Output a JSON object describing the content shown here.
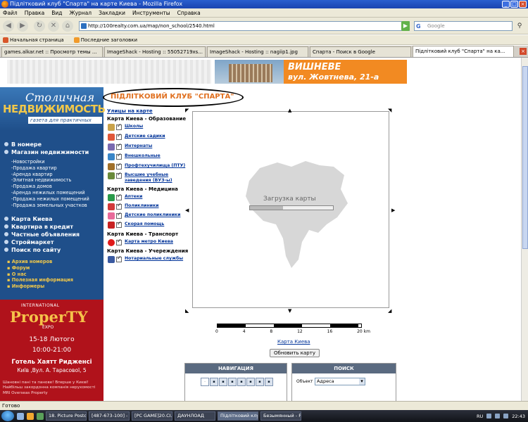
{
  "window": {
    "title": "Підлітковий клуб \"Спарта\" на карте Киева - Mozilla Firefox",
    "buttons": [
      "_",
      "□",
      "×"
    ]
  },
  "menu": [
    "Файл",
    "Правка",
    "Вид",
    "Журнал",
    "Закладки",
    "Инструменты",
    "Справка"
  ],
  "nav": {
    "url": "http://100realty.com.ua/map/non_school/2540.html",
    "search_placeholder": "Google"
  },
  "bookmarks": [
    "Начальная страница",
    "Последние заголовки"
  ],
  "tabs": [
    {
      "label": "games.alkar.net :: Просмотр темы ...",
      "active": false
    },
    {
      "label": "ImageShack - Hosting :: 55052719xs...",
      "active": false
    },
    {
      "label": "ImageShack - Hosting :: nagiip1.jpg",
      "active": false
    },
    {
      "label": "Спарта - Поиск в Google",
      "active": false
    },
    {
      "label": "Підлітковий клуб \"Спарта\" на ка...",
      "active": true
    }
  ],
  "banner": {
    "line1": "ВИШНЕВЕ",
    "line2": "вул. Жовтнева, 21-а"
  },
  "logo": {
    "top": "Столичная",
    "main": "НЕДВИЖИМОСТЬ",
    "tagline": "газета для практичных"
  },
  "sidebar": {
    "main_top": [
      "В номере",
      "Магазин недвижимости"
    ],
    "sub": [
      "-Новостройки",
      "-Продажа квартир",
      "-Аренда квартир",
      "-Элитная недвижимость",
      "-Продажа домов",
      "-Аренда нежилых помещений",
      "-Продажа нежилых помещений",
      "-Продажа земельных участков"
    ],
    "main_bottom": [
      "Карта Киева",
      "Квартира в кредит",
      "Частные объявления",
      "Строймаркет",
      "Поиск по сайту"
    ],
    "extra": [
      "Архив номеров",
      "Форум",
      "О нас",
      "Полезная информация",
      "Информеры"
    ]
  },
  "promo": {
    "top": "INTERNATIONAL",
    "brand": "ProperTY",
    "expo": "EXPO",
    "dates": "15-18 Лютого",
    "time": "10:00-21:00",
    "venue": "Готель Хаятт Ридженсі",
    "address": "Київ ,Вул. А. Тарасової, 5",
    "desc": "Шановні пані та панове! Вперше у Києві! Найбільш закордонна компанія нерухомості MRI Overseas Property"
  },
  "main": {
    "title": "ПІДЛІТКОВИЙ КЛУБ \"СПАРТА\"",
    "streets_link": "Улицы на карте",
    "groups": [
      {
        "header": "Карта Киева - Образование",
        "items": [
          "Школы",
          "Детские садики",
          "Интернаты",
          "Внешкольные",
          "Профтехучилища (ПТУ)",
          "Высшие учебные заведения (ВУЗ-ы)"
        ]
      },
      {
        "header": "Карта Киева - Медицина",
        "items": [
          "Аптеки",
          "Поликлиники",
          "Детские поликлиники",
          "Скорая помощь"
        ]
      },
      {
        "header": "Карта Киева - Транспорт",
        "items": [
          "Карта метро Киева"
        ]
      },
      {
        "header": "Карта Киева - Учереждения",
        "items": [
          "Нотариальные службы"
        ]
      }
    ],
    "loading_text": "Загрузка карты",
    "loading_progress": 0.4,
    "scale_labels": [
      "0",
      "4",
      "8",
      "12",
      "16",
      "20 km"
    ],
    "kiev_link": "Карта Киева",
    "refresh_button": "Обновить карту",
    "nav_panel_title": "НАВИГАЦИЯ",
    "search_panel_title": "ПОИСК",
    "object_label": "Объект",
    "object_value": "Адреса"
  },
  "status": "Готово",
  "taskbar": {
    "items": [
      "18. Picture Postca...",
      "[487-673-100] - O...",
      "[PC GAME]20.CI...",
      "ДАУНЛОАД",
      "Підлітковий клуб...",
      "Безымянный - P..."
    ],
    "active_index": 4,
    "lang": "RU",
    "time": "22:43"
  },
  "colors": {
    "sidebar_bg": "#1f4f8a",
    "accent_orange": "#e07020",
    "link_blue": "#003399",
    "promo_red": "#b0121b",
    "banner_orange": "#f28a22"
  }
}
